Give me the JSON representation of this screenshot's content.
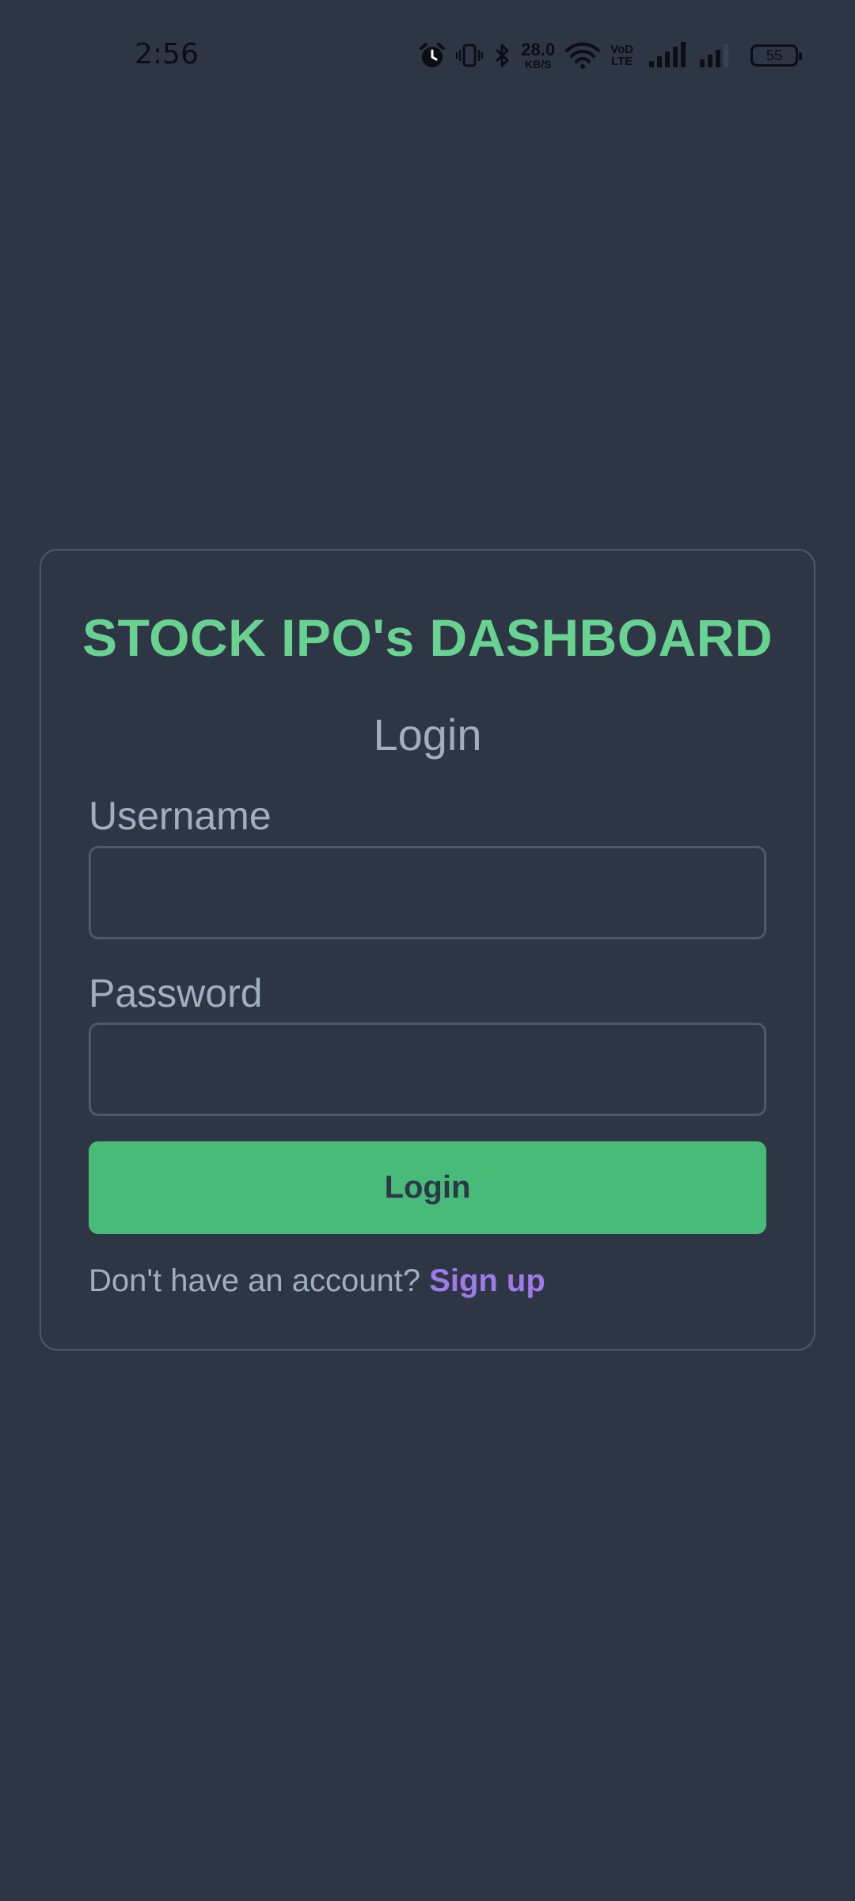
{
  "status_bar": {
    "time": "2:56",
    "net_speed_value": "28.0",
    "net_speed_unit": "KB/S",
    "volte_top": "VoD",
    "volte_bottom": "LTE",
    "battery_level": "55",
    "icons": [
      "alarm-icon",
      "vibrate-icon",
      "bluetooth-icon",
      "wifi-icon",
      "signal-icon",
      "signal-icon",
      "battery-icon"
    ]
  },
  "login_card": {
    "app_title": "STOCK IPO's DASHBOARD",
    "heading": "Login",
    "username_label": "Username",
    "username_value": "",
    "password_label": "Password",
    "password_value": "",
    "submit_label": "Login",
    "signup_prompt": "Don't have an account?",
    "signup_link": "Sign up"
  },
  "colors": {
    "background": "#2e3646",
    "title_green": "#68d391",
    "button_green": "#48bb78",
    "link_purple": "#9f7aea",
    "muted_text": "#a0aec0",
    "border": "#4f5868"
  }
}
